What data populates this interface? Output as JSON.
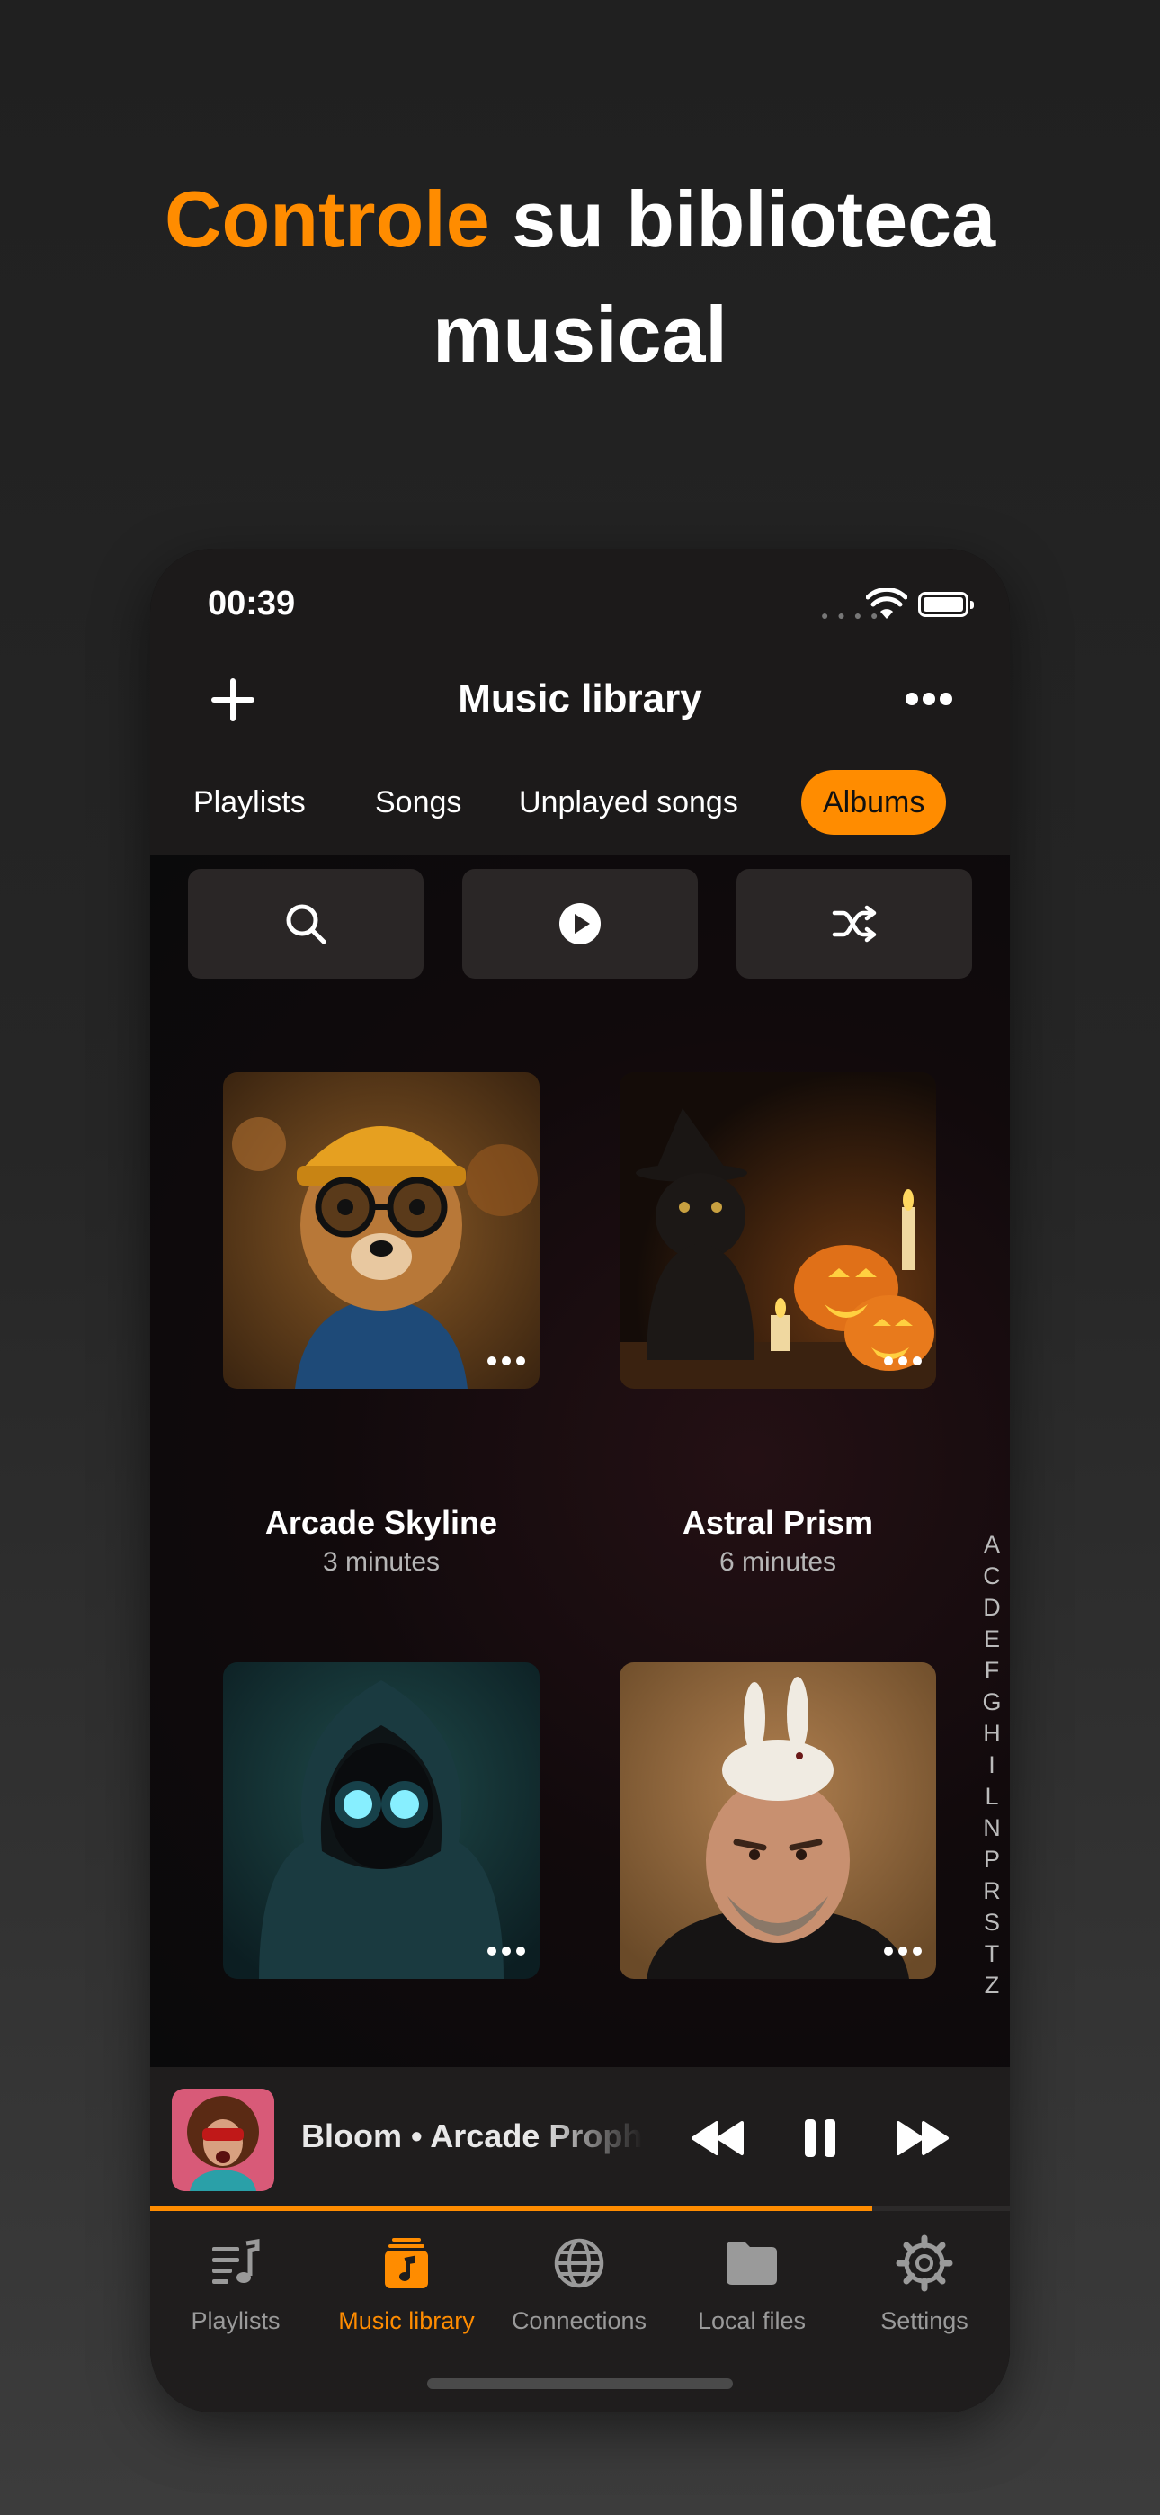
{
  "headline": {
    "accent": "Controle",
    "rest_line1": " su biblioteca",
    "line2": "musical"
  },
  "status": {
    "time": "00:39"
  },
  "nav": {
    "title": "Music library"
  },
  "tabs": [
    {
      "label": "Playlists"
    },
    {
      "label": "Songs"
    },
    {
      "label": "Unplayed songs"
    },
    {
      "label": "Albums",
      "active": true
    }
  ],
  "actions": [
    {
      "icon": "search-icon"
    },
    {
      "icon": "play-circle-icon"
    },
    {
      "icon": "shuffle-icon"
    }
  ],
  "albums": [
    {
      "title": "Arcade Skyline",
      "subtitle": "3 minutes",
      "cover": "dog-in-beanie-image"
    },
    {
      "title": "Astral Prism",
      "subtitle": "6 minutes",
      "cover": "cat-with-pumpkins-image"
    },
    {
      "title": "",
      "subtitle": "",
      "cover": "hooded-robot-image"
    },
    {
      "title": "",
      "subtitle": "",
      "cover": "man-with-rabbit-image"
    }
  ],
  "index_letters": [
    "A",
    "C",
    "D",
    "E",
    "F",
    "G",
    "H",
    "I",
    "L",
    "N",
    "P",
    "R",
    "S",
    "T",
    "Z"
  ],
  "now_playing": {
    "text": "Bloom • Arcade Prophets",
    "progress": 0.84
  },
  "tabbar": [
    {
      "label": "Playlists",
      "icon": "playlist-icon"
    },
    {
      "label": "Music library",
      "icon": "music-library-icon",
      "active": true
    },
    {
      "label": "Connections",
      "icon": "globe-icon"
    },
    {
      "label": "Local files",
      "icon": "folder-icon"
    },
    {
      "label": "Settings",
      "icon": "gear-icon"
    }
  ],
  "colors": {
    "accent": "#ff8c00",
    "inactive": "#9a9a9a"
  }
}
